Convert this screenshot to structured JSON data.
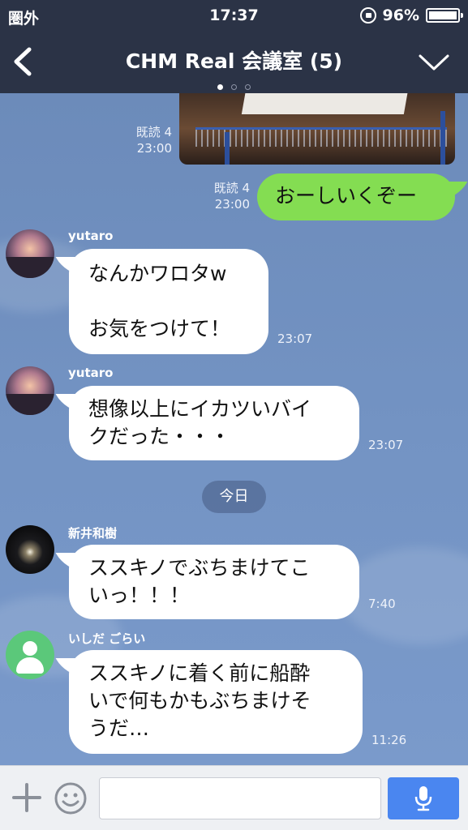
{
  "status_bar": {
    "carrier": "圏外",
    "time": "17:37",
    "battery": "96%"
  },
  "header": {
    "title": "CHM Real 会議室 (5)",
    "page_dots": 3,
    "active_dot": 0
  },
  "messages": {
    "photo": {
      "read": "既読 4",
      "time": "23:00"
    },
    "outgoing": {
      "text": "おーしいくぞー",
      "read": "既読 4",
      "time": "23:00"
    },
    "m1": {
      "sender": "yutaro",
      "line1": "なんかワロタw",
      "line2": "",
      "line3": "お気をつけて！",
      "time": "23:07"
    },
    "m2": {
      "sender": "yutaro",
      "line1": "想像以上にイカツいバイ",
      "line2": "クだった・・・",
      "time": "23:07"
    },
    "day_separator": "今日",
    "m3": {
      "sender": "新井和樹",
      "line1": "ススキノでぶちまけてこ",
      "line2": "いっ！！！",
      "time": "7:40"
    },
    "m4": {
      "sender": "いしだ ごらい",
      "line1": "ススキノに着く前に船酔",
      "line2": "いで何もかもぶちまけそ",
      "line3": "うだ…",
      "time": "11:26"
    }
  },
  "input_bar": {
    "placeholder": ""
  },
  "colors": {
    "header_bg": "#2b3346",
    "chat_bg": "#7393c3",
    "outgoing_bubble": "#84dd52",
    "incoming_bubble": "#ffffff",
    "mic_button": "#4a86f0"
  }
}
